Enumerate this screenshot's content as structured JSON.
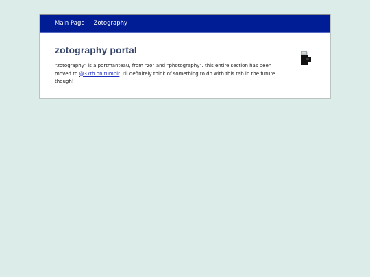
{
  "nav": {
    "items": [
      {
        "label": "Main Page"
      },
      {
        "label": "Zotography"
      }
    ]
  },
  "main": {
    "title": "zotography portal",
    "text_before_link": "\"zotography\" is a portmanteau, from \"zo\" and \"photography\". this entire section has been moved to ",
    "link_label": "@37th on tumblr",
    "text_after_link": ". I'll definitely think of something to do with this tab in the future though!",
    "icon": "camera-icon"
  }
}
